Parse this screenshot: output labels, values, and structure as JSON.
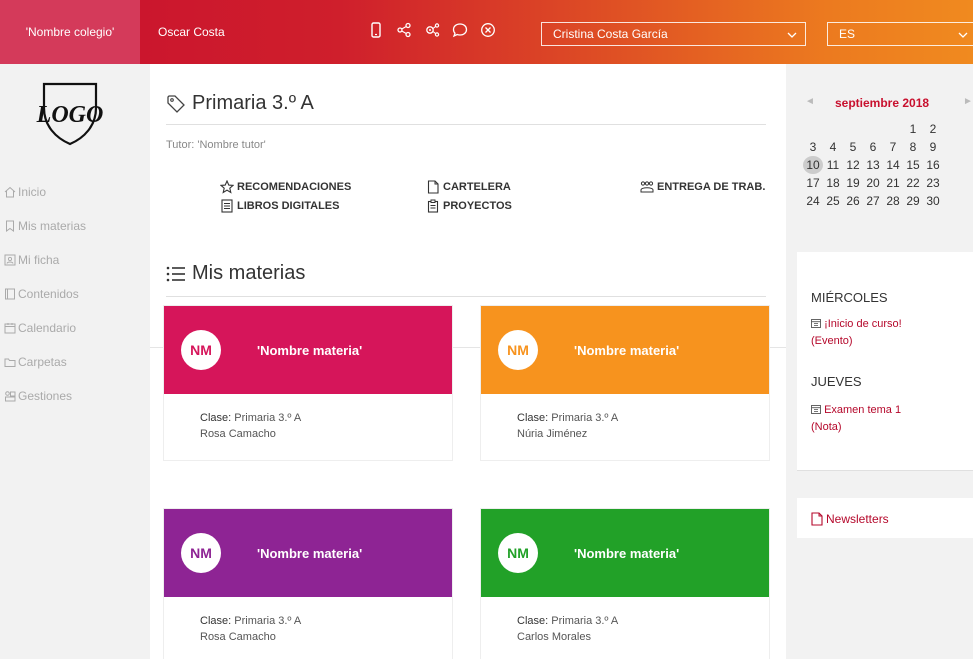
{
  "topbar": {
    "school": "'Nombre colegio'",
    "user": "Oscar Costa",
    "icons": [
      "phone-icon",
      "share-icon",
      "network-settings-icon",
      "chat-icon",
      "close-circle-icon"
    ],
    "user_select": "Cristina Costa García",
    "lang_select": "ES"
  },
  "sidebar": {
    "logo_text": "LOGO",
    "items": [
      {
        "label": "Inicio",
        "icon": "home-icon"
      },
      {
        "label": "Mis materias",
        "icon": "bookmark-icon"
      },
      {
        "label": "Mi ficha",
        "icon": "id-card-icon"
      },
      {
        "label": "Contenidos",
        "icon": "book-icon"
      },
      {
        "label": "Calendario",
        "icon": "calendar-icon"
      },
      {
        "label": "Carpetas",
        "icon": "folder-icon"
      },
      {
        "label": "Gestiones",
        "icon": "manage-icon"
      }
    ]
  },
  "main": {
    "title": "Primaria 3.º A",
    "tutor": "Tutor: 'Nombre tutor'",
    "links": [
      {
        "label": "RECOMENDACIONES",
        "icon": "star-icon"
      },
      {
        "label": "CARTELERA",
        "icon": "file-icon"
      },
      {
        "label": "ENTREGA DE TRAB.",
        "icon": "group-icon"
      },
      {
        "label": "LIBROS DIGITALES",
        "icon": "book-icon"
      },
      {
        "label": "PROYECTOS",
        "icon": "clipboard-icon"
      }
    ],
    "subjects_title": "Mis materias",
    "cards": [
      {
        "initials": "NM",
        "name": "'Nombre materia'",
        "class_label": "Clase:",
        "class_value": "Primaria 3.º A",
        "teacher": "Rosa Camacho",
        "color": "#d6155a"
      },
      {
        "initials": "NM",
        "name": "'Nombre materia'",
        "class_label": "Clase:",
        "class_value": "Primaria 3.º A",
        "teacher": "Núria Jiménez",
        "color": "#f7931e"
      },
      {
        "initials": "NM",
        "name": "'Nombre materia'",
        "class_label": "Clase:",
        "class_value": "Primaria 3.º A",
        "teacher": "Rosa Camacho",
        "color": "#8e2494"
      },
      {
        "initials": "NM",
        "name": "'Nombre materia'",
        "class_label": "Clase:",
        "class_value": "Primaria 3.º A",
        "teacher": "Carlos Morales",
        "color": "#22a128"
      }
    ]
  },
  "calendar": {
    "prev": "◄",
    "month": "septiembre 2018",
    "next": "►",
    "today": "10",
    "weeks": [
      [
        "",
        "",
        "",
        "",
        "",
        "1",
        "2"
      ],
      [
        "3",
        "4",
        "5",
        "6",
        "7",
        "8",
        "9"
      ],
      [
        "10",
        "11",
        "12",
        "13",
        "14",
        "15",
        "16"
      ],
      [
        "17",
        "18",
        "19",
        "20",
        "21",
        "22",
        "23"
      ],
      [
        "24",
        "25",
        "26",
        "27",
        "28",
        "29",
        "30"
      ]
    ]
  },
  "events": {
    "day1": "MIÉRCOLES",
    "event1_line1": "¡Inicio de curso!",
    "event1_line2": "(Evento)",
    "day2": "JUEVES",
    "event2_line1": "Examen tema 1",
    "event2_line2": "(Nota)"
  },
  "newsletter": {
    "label": "Newsletters"
  },
  "colors": {
    "accent": "#c8102e",
    "event": "#b5082b"
  }
}
